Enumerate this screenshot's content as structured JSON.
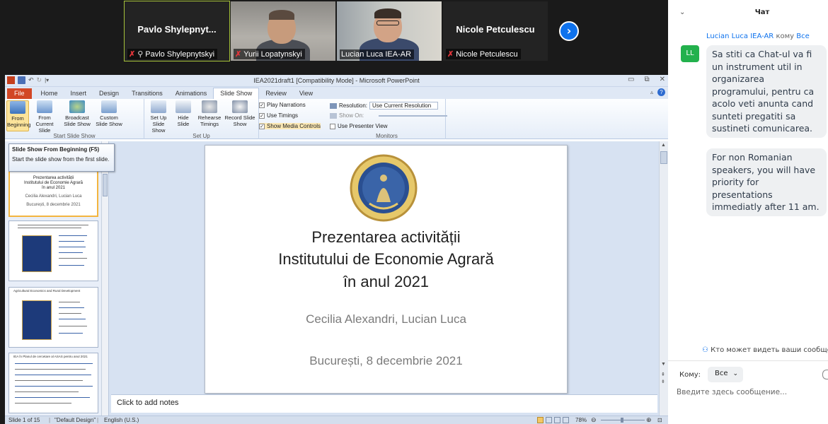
{
  "video_strip": {
    "tiles": [
      {
        "display_name": "Pavlo  Shylepnyt...",
        "label": "Pavlo Shylepnytskyi"
      },
      {
        "label": "Yurii Lopatynskyi"
      },
      {
        "label": "Lucian Luca IEA-AR"
      },
      {
        "display_name": "Nicole Petculescu",
        "label": "Nicole Petculescu"
      }
    ],
    "next_icon": "chevron-right-icon"
  },
  "powerpoint": {
    "window_title": "IEA2021draft1 [Compatibility Mode] - Microsoft PowerPoint",
    "tabs": [
      "File",
      "Home",
      "Insert",
      "Design",
      "Transitions",
      "Animations",
      "Slide Show",
      "Review",
      "View"
    ],
    "selected_tab": "Slide Show",
    "ribbon": {
      "start_group": "Start Slide Show",
      "from_beginning": "From Beginning",
      "from_current": "From Current Slide",
      "broadcast": "Broadcast Slide Show",
      "custom": "Custom Slide Show",
      "setup_group": "Set Up",
      "setup_show": "Set Up Slide Show",
      "hide_slide": "Hide Slide",
      "rehearse": "Rehearse Timings",
      "record": "Record Slide Show",
      "play_narrations": "Play Narrations",
      "use_timings": "Use Timings",
      "show_media_controls": "Show Media Controls",
      "monitors_group": "Monitors",
      "resolution_label": "Resolution:",
      "resolution_value": "Use Current Resolution",
      "show_on_label": "Show On:",
      "use_presenter_view": "Use Presenter View"
    },
    "tooltip": {
      "title": "Slide Show From Beginning (F5)",
      "body": "Start the slide show from the first slide."
    },
    "thumbnails": [
      {
        "num": "1",
        "lines": [
          "Prezentarea activității",
          "Institutului de Economie Agrară",
          "în anul 2021",
          "Cecilia Alexandri, Lucian Luca",
          "București, 8 decembrie 2021"
        ]
      },
      {
        "num": "2"
      },
      {
        "num": "3",
        "title": "Agricultural Economics and Rural Development"
      },
      {
        "num": "4",
        "title": "IEA în Planul de cercetare al ASAS pentru anul 2021"
      }
    ],
    "slide": {
      "title_line1": "Prezentarea activității",
      "title_line2": "Institutului de Economie Agrară",
      "title_line3": "în anul 2021",
      "authors": "Cecilia Alexandri, Lucian Luca",
      "place_date": "București, 8 decembrie 2021",
      "seal_text": "INSTITUTUL DE ECONOMIE AGRARĂ"
    },
    "notes_placeholder": "Click to add notes",
    "status": {
      "slide_info": "Slide 1 of 15",
      "theme": "\"Default Design\"",
      "language": "English (U.S.)",
      "zoom": "78%"
    }
  },
  "chat": {
    "title": "Чат",
    "sender": "Lucian Luca IEA-AR",
    "to_word": "кому",
    "recipient": "Все",
    "avatar_initials": "LL",
    "messages": [
      "Sa stiti ca Chat-ul va fi un instrument util in organizarea programului, pentru ca acolo veti anunta cand sunteti pregatiti sa sustineti comunicarea.",
      "For non Romanian speakers, you will have priority for presentations immediatly after 11 am."
    ],
    "who_can_see": "Кто может видеть ваши сообщения",
    "to_label": "Кому:",
    "to_value": "Все",
    "input_placeholder": "Введите здесь сообщение..."
  }
}
